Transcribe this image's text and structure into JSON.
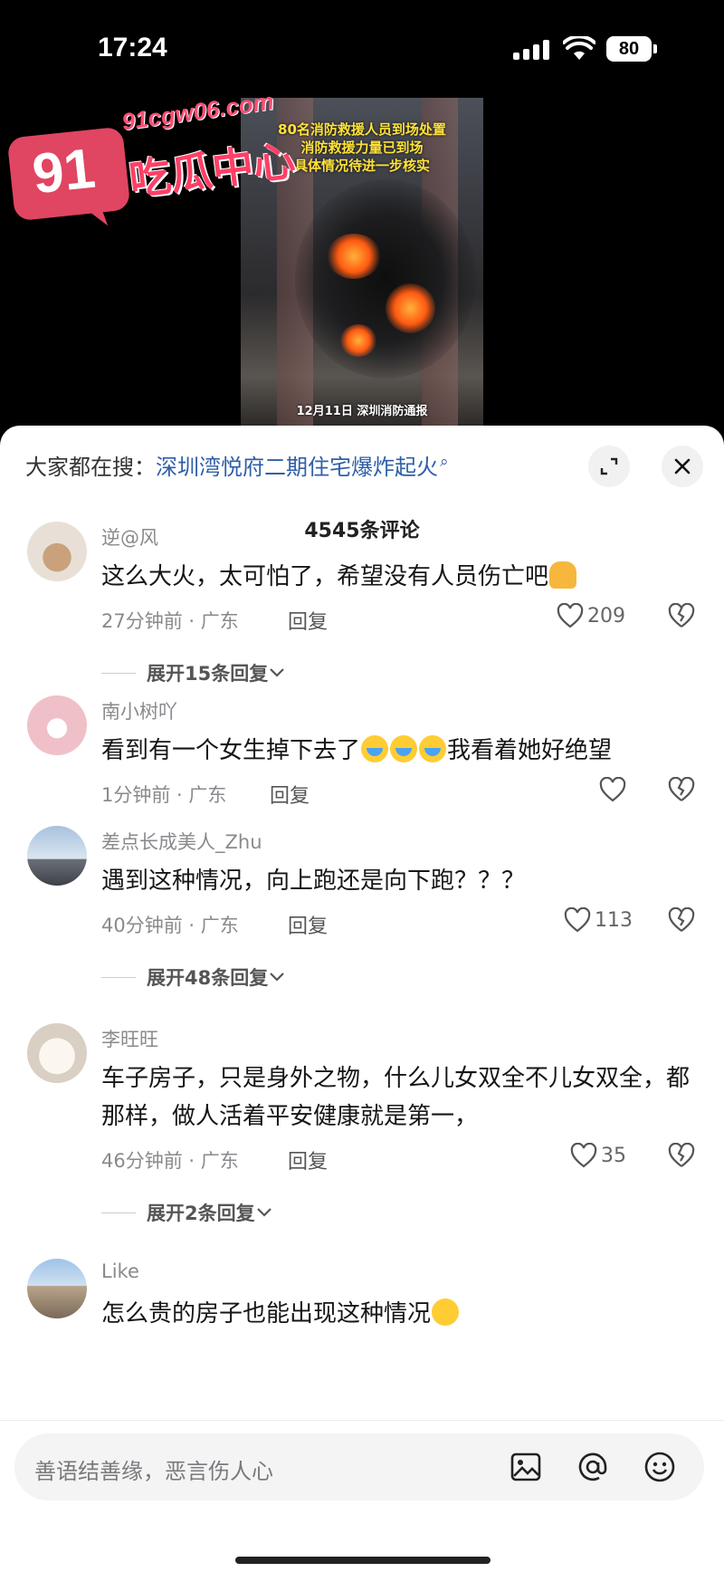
{
  "status_bar": {
    "time": "17:24",
    "battery": "80"
  },
  "video": {
    "overlay_lines": [
      "80名消防救援人员到场处置",
      "消防救援力量已到场",
      "具体情况待进一步核实"
    ],
    "caption": "12月11日 深圳消防通报"
  },
  "watermark": {
    "number": "91",
    "url": "91cgw06.com",
    "name": "吃瓜中心"
  },
  "sheet": {
    "search_label": "大家都在搜：",
    "search_query": "深圳湾悦府二期住宅爆炸起火",
    "comment_count": "4545条评论"
  },
  "comments": [
    {
      "user": "逆@风",
      "text": "这么大火，太可怕了，希望没有人员伤亡吧",
      "emoji": "pray",
      "time": "27分钟前 · 广东",
      "reply": "回复",
      "likes": "209",
      "expand": "展开15条回复"
    },
    {
      "user": "南小树吖",
      "text_before": "看到有一个女生掉下去了",
      "text_after": "我看着她好绝望",
      "time": "1分钟前 · 广东",
      "reply": "回复",
      "likes": ""
    },
    {
      "user": "差点长成美人_Zhu",
      "text": "遇到这种情况，向上跑还是向下跑？？？",
      "time": "40分钟前 · 广东",
      "reply": "回复",
      "likes": "113",
      "expand": "展开48条回复"
    },
    {
      "user": "李旺旺",
      "text": "车子房子，只是身外之物，什么儿女双全不儿女双全，都那样，做人活着平安健康就是第一，",
      "time": "46分钟前 · 广东",
      "reply": "回复",
      "likes": "35",
      "expand": "展开2条回复"
    },
    {
      "user": "Like",
      "text": "怎么贵的房子也能出现这种情况",
      "emoji": "pleading"
    }
  ],
  "input": {
    "placeholder": "善语结善缘，恶言伤人心"
  },
  "icons": [
    "heart-icon",
    "broken-heart-icon",
    "image-icon",
    "at-icon",
    "emoji-icon",
    "expand-icon",
    "close-icon",
    "search-icon",
    "chevron-down-icon"
  ]
}
